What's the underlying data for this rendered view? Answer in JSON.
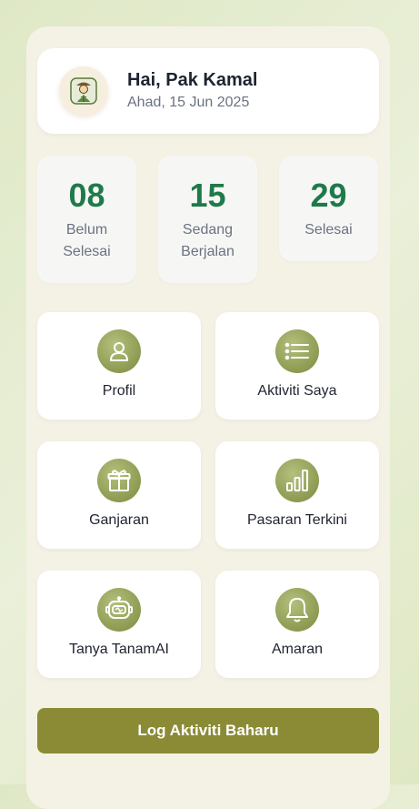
{
  "header": {
    "greeting": "Hai, Pak Kamal",
    "date": "Ahad, 15 Jun 2025"
  },
  "stats": [
    {
      "value": "08",
      "label_line1": "Belum",
      "label_line2": "Selesai"
    },
    {
      "value": "15",
      "label_line1": "Sedang",
      "label_line2": "Berjalan"
    },
    {
      "value": "29",
      "label_line1": "Selesai",
      "label_line2": ""
    }
  ],
  "menu": [
    {
      "label": "Profil",
      "icon": "user-icon"
    },
    {
      "label": "Aktiviti Saya",
      "icon": "list-icon"
    },
    {
      "label": "Ganjaran",
      "icon": "gift-icon"
    },
    {
      "label": "Pasaran Terkini",
      "icon": "bar-chart-icon"
    },
    {
      "label": "Tanya TanamAI",
      "icon": "robot-icon"
    },
    {
      "label": "Amaran",
      "icon": "bell-icon"
    }
  ],
  "cta": {
    "label": "Log Aktiviti Baharu"
  },
  "colors": {
    "accent": "#8b8b36",
    "stat_number": "#1f7a4a",
    "icon_bg": "#9aa75e"
  }
}
